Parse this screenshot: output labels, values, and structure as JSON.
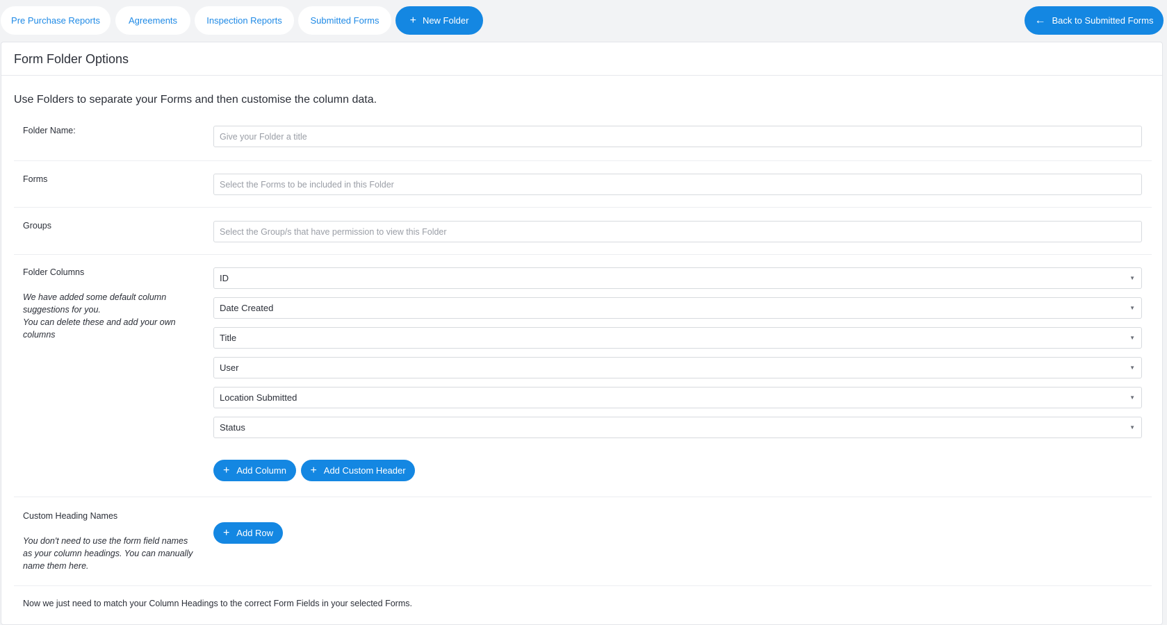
{
  "tabs": [
    {
      "label": "Pre Purchase Reports"
    },
    {
      "label": "Agreements"
    },
    {
      "label": "Inspection Reports"
    },
    {
      "label": "Submitted Forms"
    }
  ],
  "new_folder": {
    "label": "New Folder",
    "icon": "plus-icon"
  },
  "back_button": {
    "label": "Back to Submitted Forms",
    "icon": "arrow-left-icon"
  },
  "panel": {
    "title": "Form Folder Options"
  },
  "intro": "Use Folders to separate your Forms and then customise the column data.",
  "folder_name": {
    "label": "Folder Name:",
    "placeholder": "Give your Folder a title"
  },
  "forms": {
    "label": "Forms",
    "placeholder": "Select the Forms to be included in this Folder"
  },
  "groups": {
    "label": "Groups",
    "placeholder": "Select the Group/s that have permission to view this Folder"
  },
  "folder_columns": {
    "label": "Folder Columns",
    "help_1": "We have added some default column suggestions for you.",
    "help_2": "You can delete these and add your own columns",
    "columns": [
      "ID",
      "Date Created",
      "Title",
      "User",
      "Location Submitted",
      "Status"
    ],
    "add_column": "Add Column",
    "add_custom_header": "Add Custom Header"
  },
  "custom_headings": {
    "label": "Custom Heading Names",
    "help": "You don't need to use the form field names as your column headings. You can manually name them here.",
    "add_row": "Add Row"
  },
  "footer": "Now we just need to match your Column Headings to the correct Form Fields in your selected Forms.",
  "colors": {
    "accent": "#1487e2",
    "link": "#1f8ae6",
    "background": "#f2f3f5"
  }
}
